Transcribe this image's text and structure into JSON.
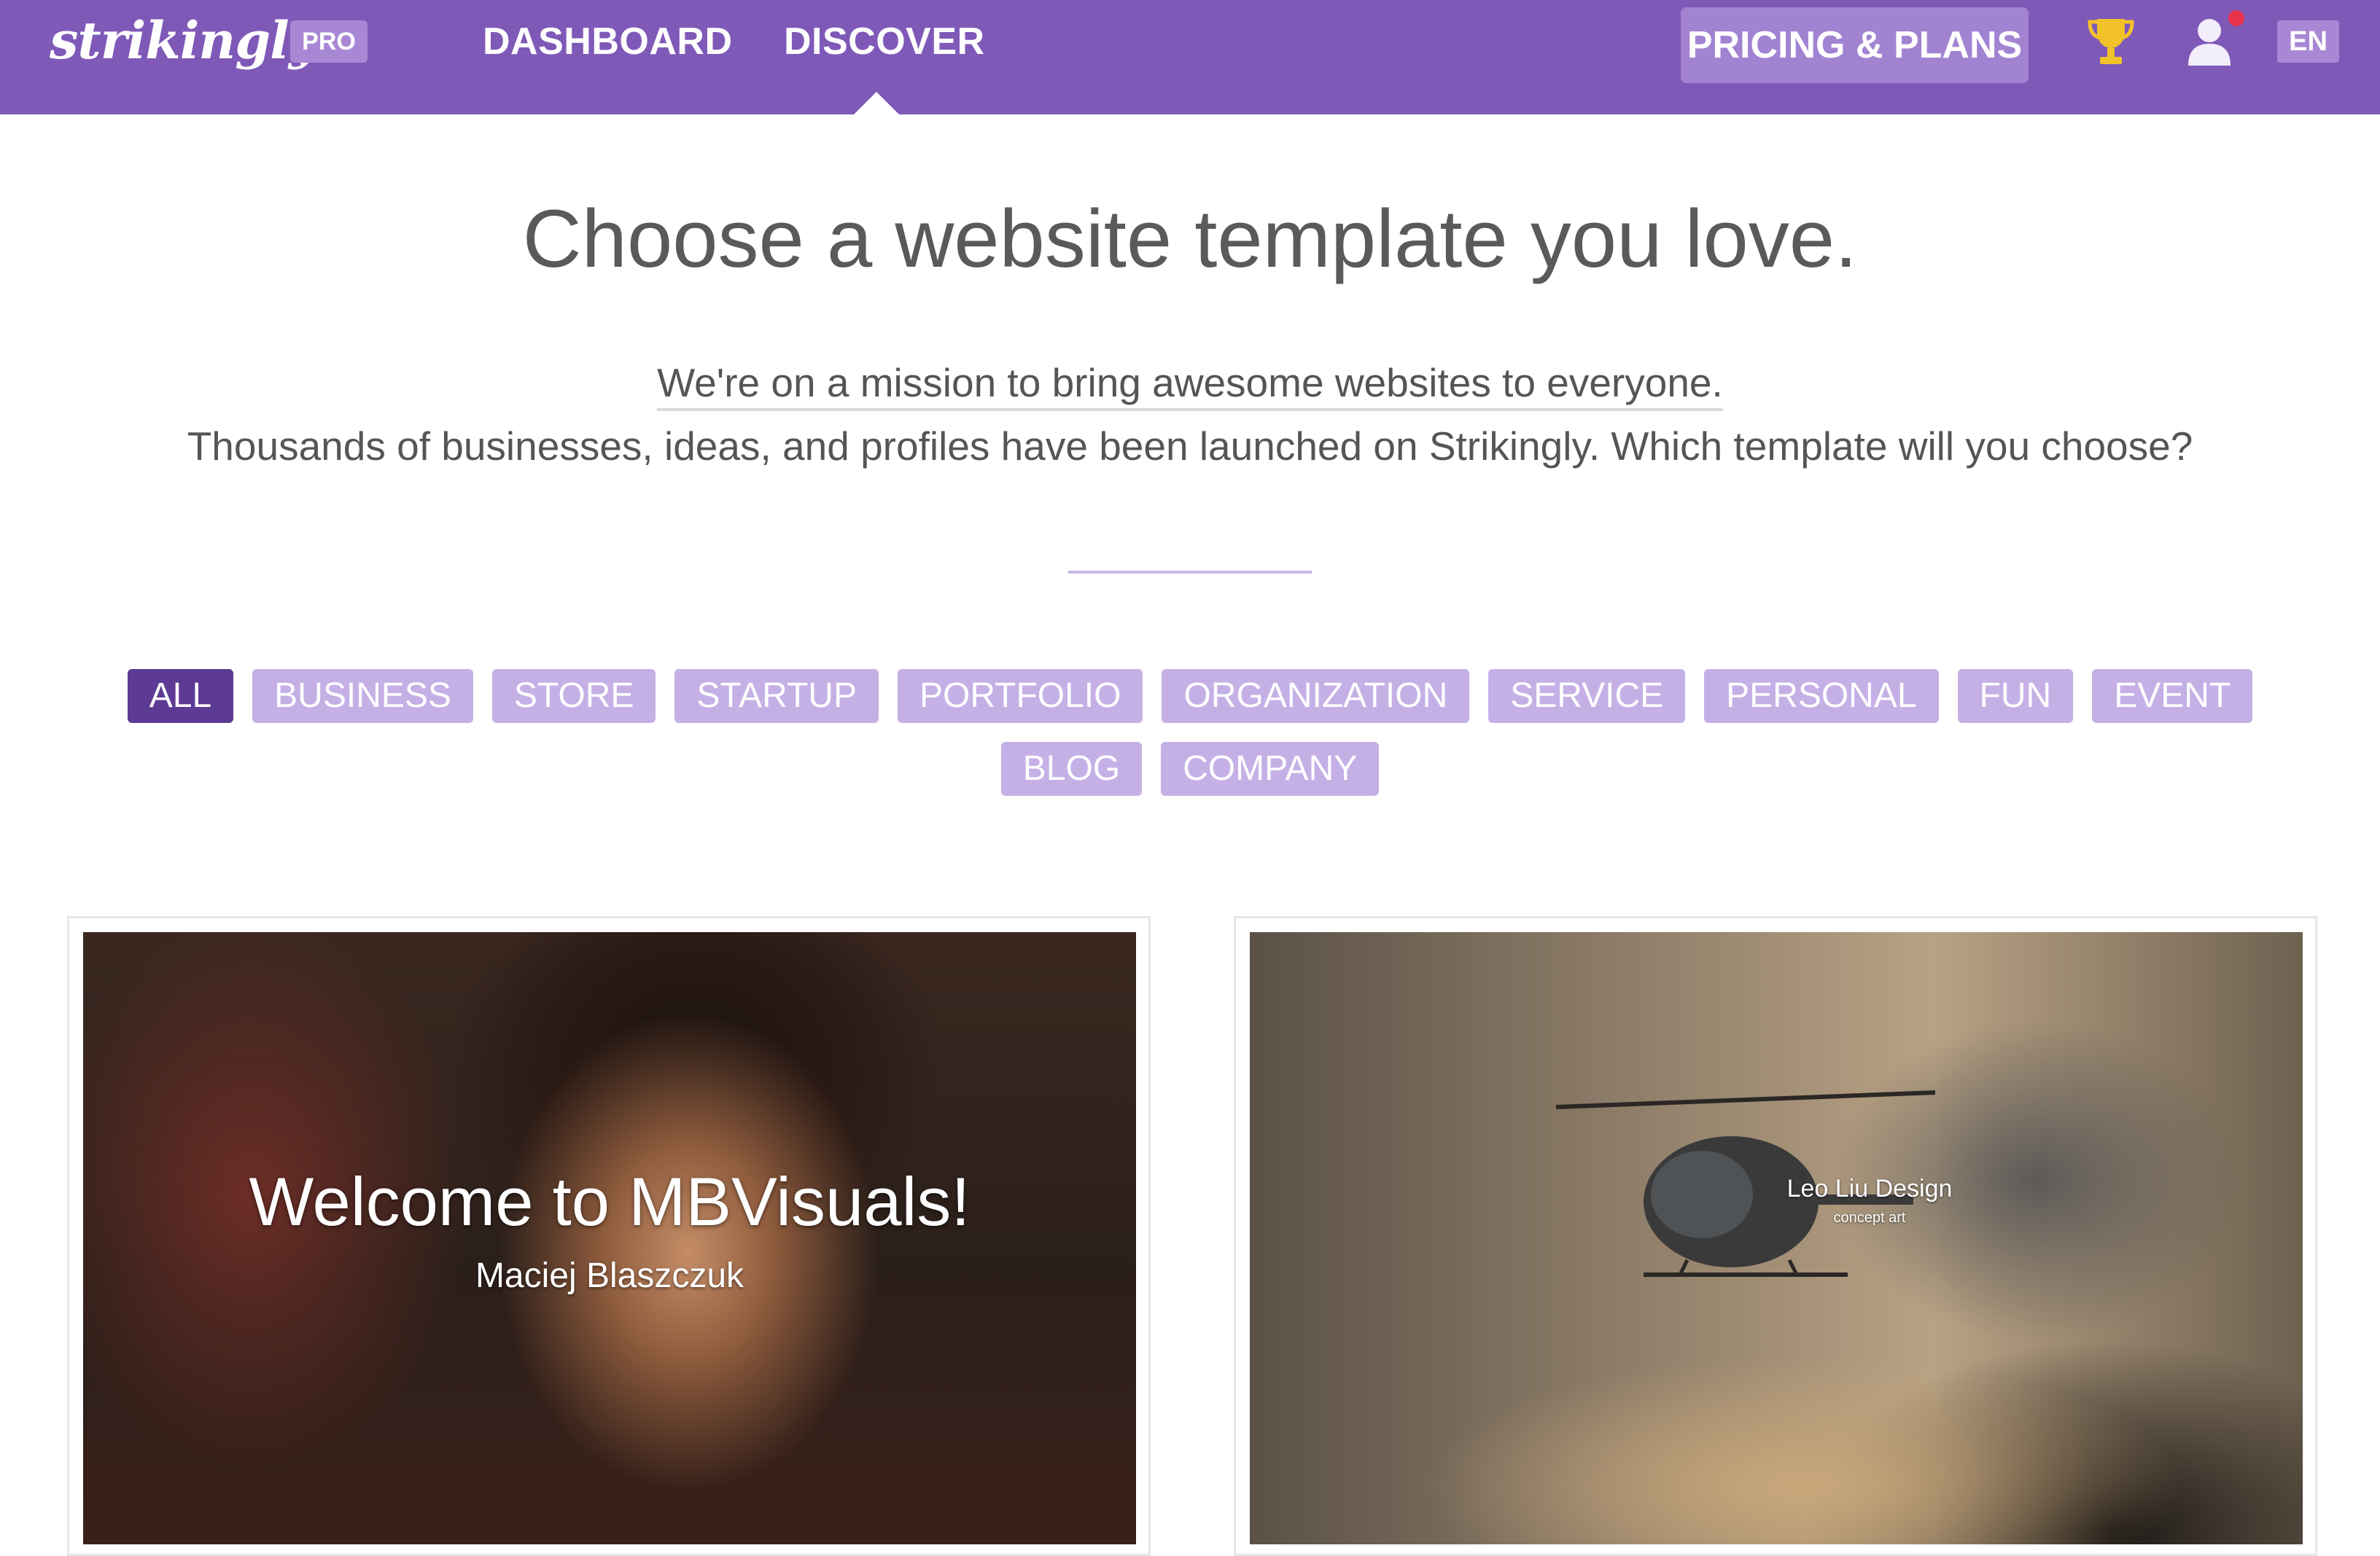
{
  "navbar": {
    "logo_text": "strikingly",
    "pro_badge": "PRO",
    "links": [
      "DASHBOARD",
      "DISCOVER"
    ],
    "active_link": "DISCOVER",
    "pricing_button": "PRICING & PLANS",
    "language": "EN",
    "icons": [
      "trophy-icon",
      "user-icon"
    ],
    "has_notification": true,
    "brand_color": "#7f59b8"
  },
  "hero": {
    "headline": "Choose a website template you love.",
    "mission": "We're on a mission to bring awesome websites to everyone.",
    "subline": "Thousands of businesses, ideas, and profiles have been launched on Strikingly. Which template will you choose?"
  },
  "filters": {
    "active": "ALL",
    "items": [
      "ALL",
      "BUSINESS",
      "STORE",
      "STARTUP",
      "PORTFOLIO",
      "ORGANIZATION",
      "SERVICE",
      "PERSONAL",
      "FUN",
      "EVENT",
      "BLOG",
      "COMPANY"
    ],
    "active_color": "#5d3a93",
    "inactive_color": "#c5b0e6"
  },
  "templates": [
    {
      "title": "Welcome to MBVisuals!",
      "subtitle": "Maciej Blaszczuk"
    },
    {
      "title": "Leo Liu Design",
      "subtitle": "concept art"
    }
  ]
}
